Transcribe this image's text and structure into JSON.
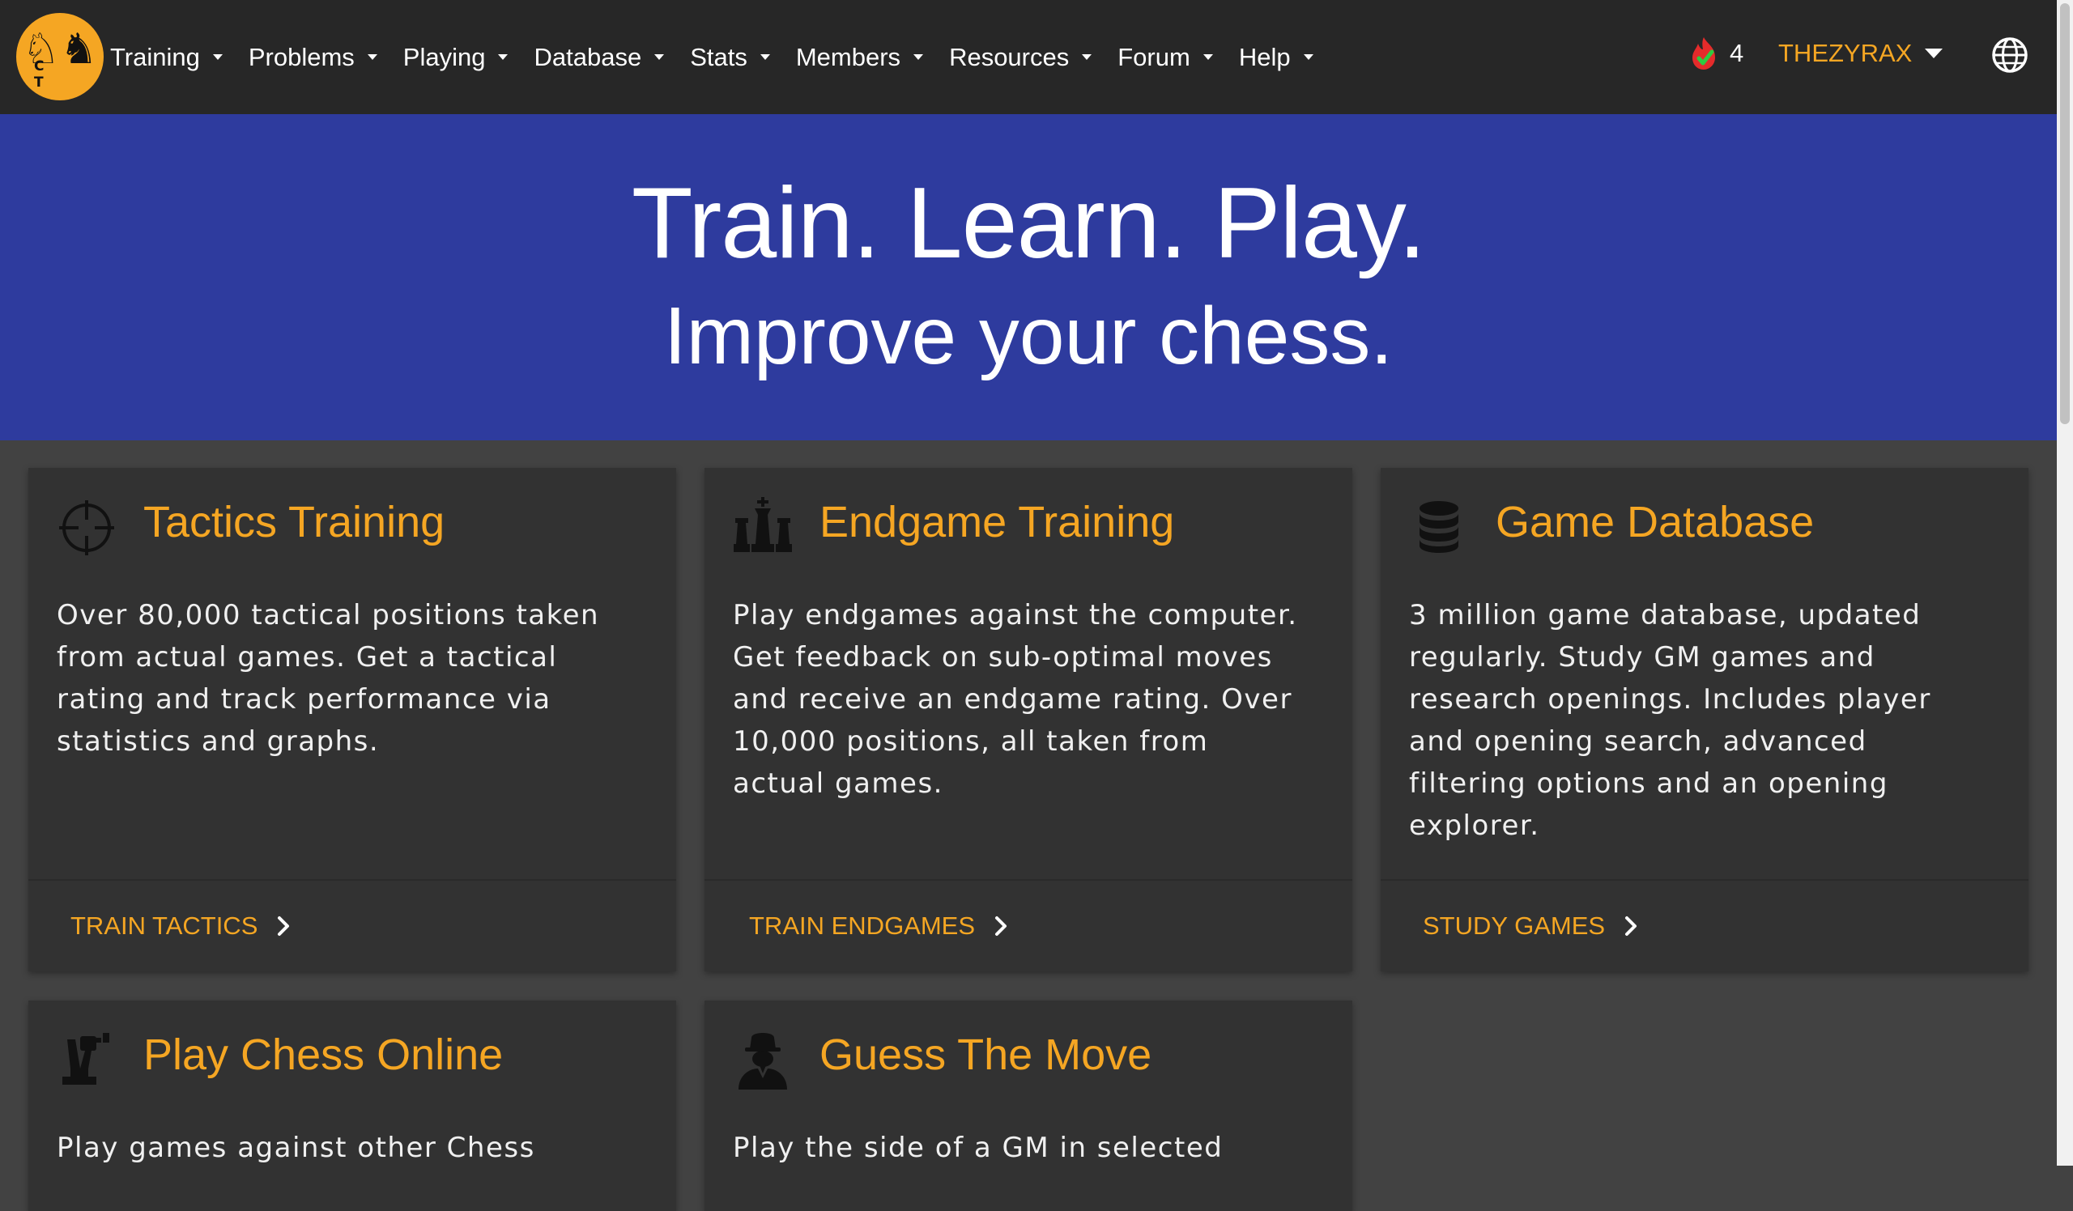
{
  "navbar": {
    "logo_letters": "C T",
    "menu": [
      {
        "label": "Training"
      },
      {
        "label": "Problems"
      },
      {
        "label": "Playing"
      },
      {
        "label": "Database"
      },
      {
        "label": "Stats"
      },
      {
        "label": "Members"
      },
      {
        "label": "Resources"
      },
      {
        "label": "Forum"
      },
      {
        "label": "Help"
      }
    ],
    "streak_count": "4",
    "username": "THEZYRAX"
  },
  "hero": {
    "title": "Train. Learn. Play.",
    "subtitle": "Improve your chess."
  },
  "cards": [
    {
      "icon": "crosshair-icon",
      "title": "Tactics Training",
      "text": "Over 80,000 tactical positions taken from actual games. Get a tactical rating and track performance via statistics and graphs.",
      "link": "TRAIN TACTICS"
    },
    {
      "icon": "chess-pieces-icon",
      "title": "Endgame Training",
      "text": "Play endgames against the computer. Get feedback on sub-optimal moves and receive an endgame rating. Over 10,000 positions, all taken from actual games.",
      "link": "TRAIN ENDGAMES"
    },
    {
      "icon": "database-icon",
      "title": "Game Database",
      "text": "3 million game database, updated regularly. Study GM games and research openings. Includes player and opening search, advanced filtering options and an opening explorer.",
      "link": "STUDY GAMES"
    },
    {
      "icon": "chess-robot-icon",
      "title": "Play Chess Online",
      "text": "Play games against other Chess"
    },
    {
      "icon": "user-secret-icon",
      "title": "Guess The Move",
      "text": "Play the side of a GM in selected"
    }
  ],
  "colors": {
    "accent": "#f5a623",
    "hero_bg": "#2e3b9e",
    "navbar_bg": "#272727",
    "card_bg": "#323232",
    "page_bg": "#424242"
  }
}
